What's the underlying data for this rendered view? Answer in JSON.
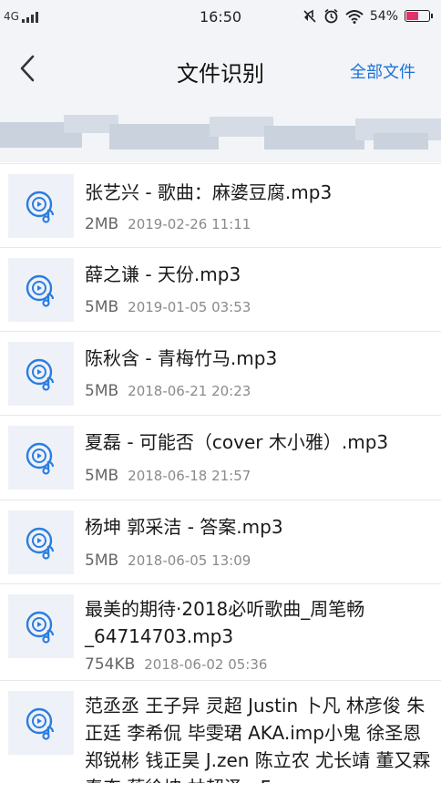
{
  "status_bar": {
    "network": "4G",
    "time": "16:50",
    "battery_percent": "54%",
    "battery_level": 0.54,
    "battery_color": "#e0336b",
    "icons": [
      "signal-icon",
      "mute-icon",
      "alarm-icon",
      "wifi-icon",
      "battery-icon"
    ]
  },
  "nav": {
    "back_icon": "chevron-left-icon",
    "title": "文件识别",
    "all_files": "全部文件"
  },
  "accent_color": "#1e72d8",
  "files": [
    {
      "name": "张艺兴 - 歌曲：麻婆豆腐.mp3",
      "size": "2MB",
      "date": "2019-02-26 11:11",
      "icon": "music-file-icon"
    },
    {
      "name": "薛之谦 - 天份.mp3",
      "size": "5MB",
      "date": "2019-01-05 03:53",
      "icon": "music-file-icon"
    },
    {
      "name": "陈秋含 - 青梅竹马.mp3",
      "size": "5MB",
      "date": "2018-06-21 20:23",
      "icon": "music-file-icon"
    },
    {
      "name": "夏磊 - 可能否（cover 木小雅）.mp3",
      "size": "5MB",
      "date": "2018-06-18 21:57",
      "icon": "music-file-icon"
    },
    {
      "name": "杨坤 郭采洁 - 答案.mp3",
      "size": "5MB",
      "date": "2018-06-05 13:09",
      "icon": "music-file-icon"
    },
    {
      "name": "最美的期待·2018必听歌曲_周笔畅_64714703.mp3",
      "size": "754KB",
      "date": "2018-06-02 05:36",
      "icon": "music-file-icon"
    },
    {
      "name": "范丞丞 王子异 灵超 Justin 卜凡 林彦俊 朱正廷 李希侃 毕雯珺 AKA.imp小鬼 徐圣恩 郑锐彬 钱正昊 J.zen 陈立农 尤长靖 董又霖 秦奋 蔡徐坤 林超泽 - Forever",
      "size": "",
      "date": "",
      "icon": "music-file-icon"
    }
  ]
}
